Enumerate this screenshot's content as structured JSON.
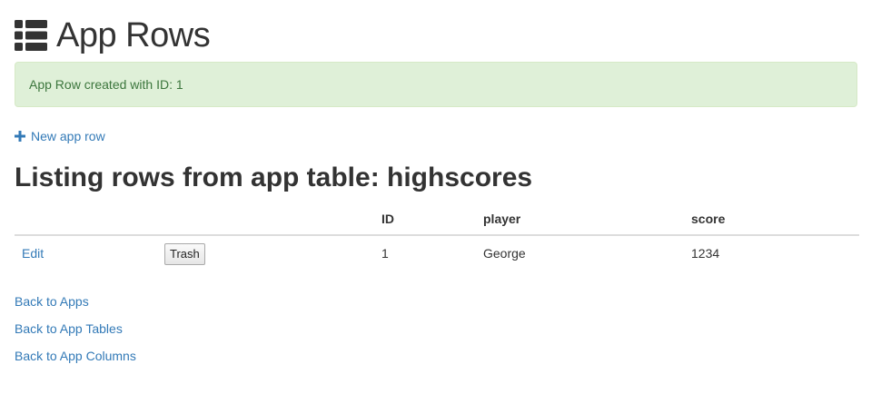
{
  "header": {
    "title": "App Rows",
    "icon": "list-icon"
  },
  "alert": {
    "message": "App Row created with ID: 1",
    "color": "#3c763d",
    "background": "#dff0d8"
  },
  "actions": {
    "new_row_label": "New app row",
    "new_row_icon": "plus-icon"
  },
  "listing": {
    "title": "Listing rows from app table: highscores",
    "columns": [
      "",
      "",
      "ID",
      "player",
      "score"
    ],
    "rows": [
      {
        "edit_label": "Edit",
        "trash_label": "Trash",
        "id": "1",
        "player": "George",
        "score": "1234"
      }
    ]
  },
  "footer_links": {
    "back_to_apps": "Back to Apps",
    "back_to_app_tables": "Back to App Tables",
    "back_to_app_columns": "Back to App Columns"
  },
  "colors": {
    "link": "#337ab7",
    "text": "#333333"
  }
}
